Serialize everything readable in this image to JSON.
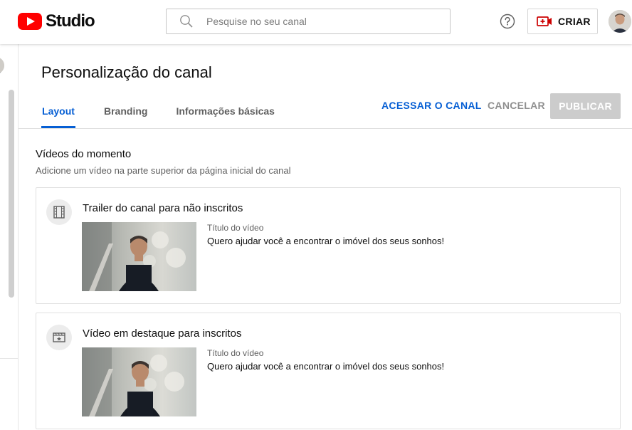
{
  "app": {
    "logo_text": "Studio",
    "brand_color": "#ff0000",
    "accent_color": "#065fd4"
  },
  "search": {
    "placeholder": "Pesquise no seu canal",
    "icon": "search-icon"
  },
  "topbar": {
    "help_icon": "help-icon",
    "create_label": "CRIAR",
    "create_icon": "video-camera-plus-icon"
  },
  "page": {
    "title": "Personalização do canal",
    "tabs": [
      {
        "label": "Layout",
        "active": true
      },
      {
        "label": "Branding",
        "active": false
      },
      {
        "label": "Informações básicas",
        "active": false
      }
    ],
    "actions": {
      "visit": "ACESSAR O CANAL",
      "cancel": "CANCELAR",
      "publish": "PUBLICAR"
    }
  },
  "section": {
    "title": "Vídeos do momento",
    "subtitle": "Adicione um vídeo na parte superior da página inicial do canal",
    "cards": [
      {
        "title": "Trailer do canal para não inscritos",
        "icon": "film-strip-icon",
        "meta_label": "Título do vídeo",
        "video_title": "Quero ajudar você a encontrar o imóvel dos seus sonhos!"
      },
      {
        "title": "Vídeo em destaque para inscritos",
        "icon": "featured-video-icon",
        "meta_label": "Título do vídeo",
        "video_title": "Quero ajudar você a encontrar o imóvel dos seus sonhos!"
      }
    ]
  }
}
